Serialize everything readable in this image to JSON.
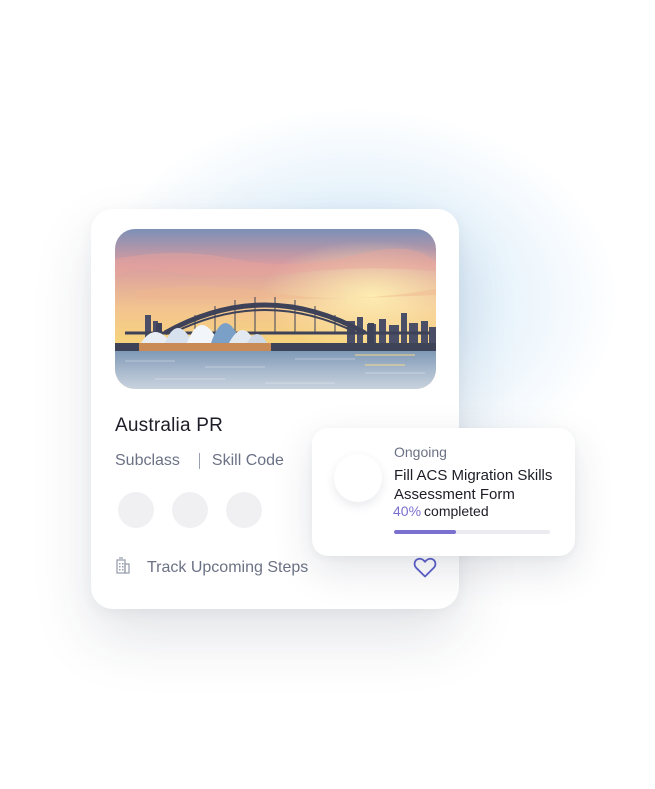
{
  "card": {
    "title": "Australia PR",
    "subclass_label": "Subclass",
    "skill_code_label": "Skill Code",
    "track_label": "Track Upcoming Steps",
    "hero_icon": "sydney-harbour-image",
    "track_icon": "building-icon",
    "favorite_icon": "heart-icon"
  },
  "popup": {
    "status": "Ongoing",
    "task": "Fill ACS Migration Skills Assessment Form",
    "progress_percent": "40%",
    "progress_suffix": "completed",
    "progress_value": 0.4
  },
  "colors": {
    "accent": "#7b6fd0",
    "text_primary": "#1d1d27",
    "text_muted": "#6b7285"
  }
}
